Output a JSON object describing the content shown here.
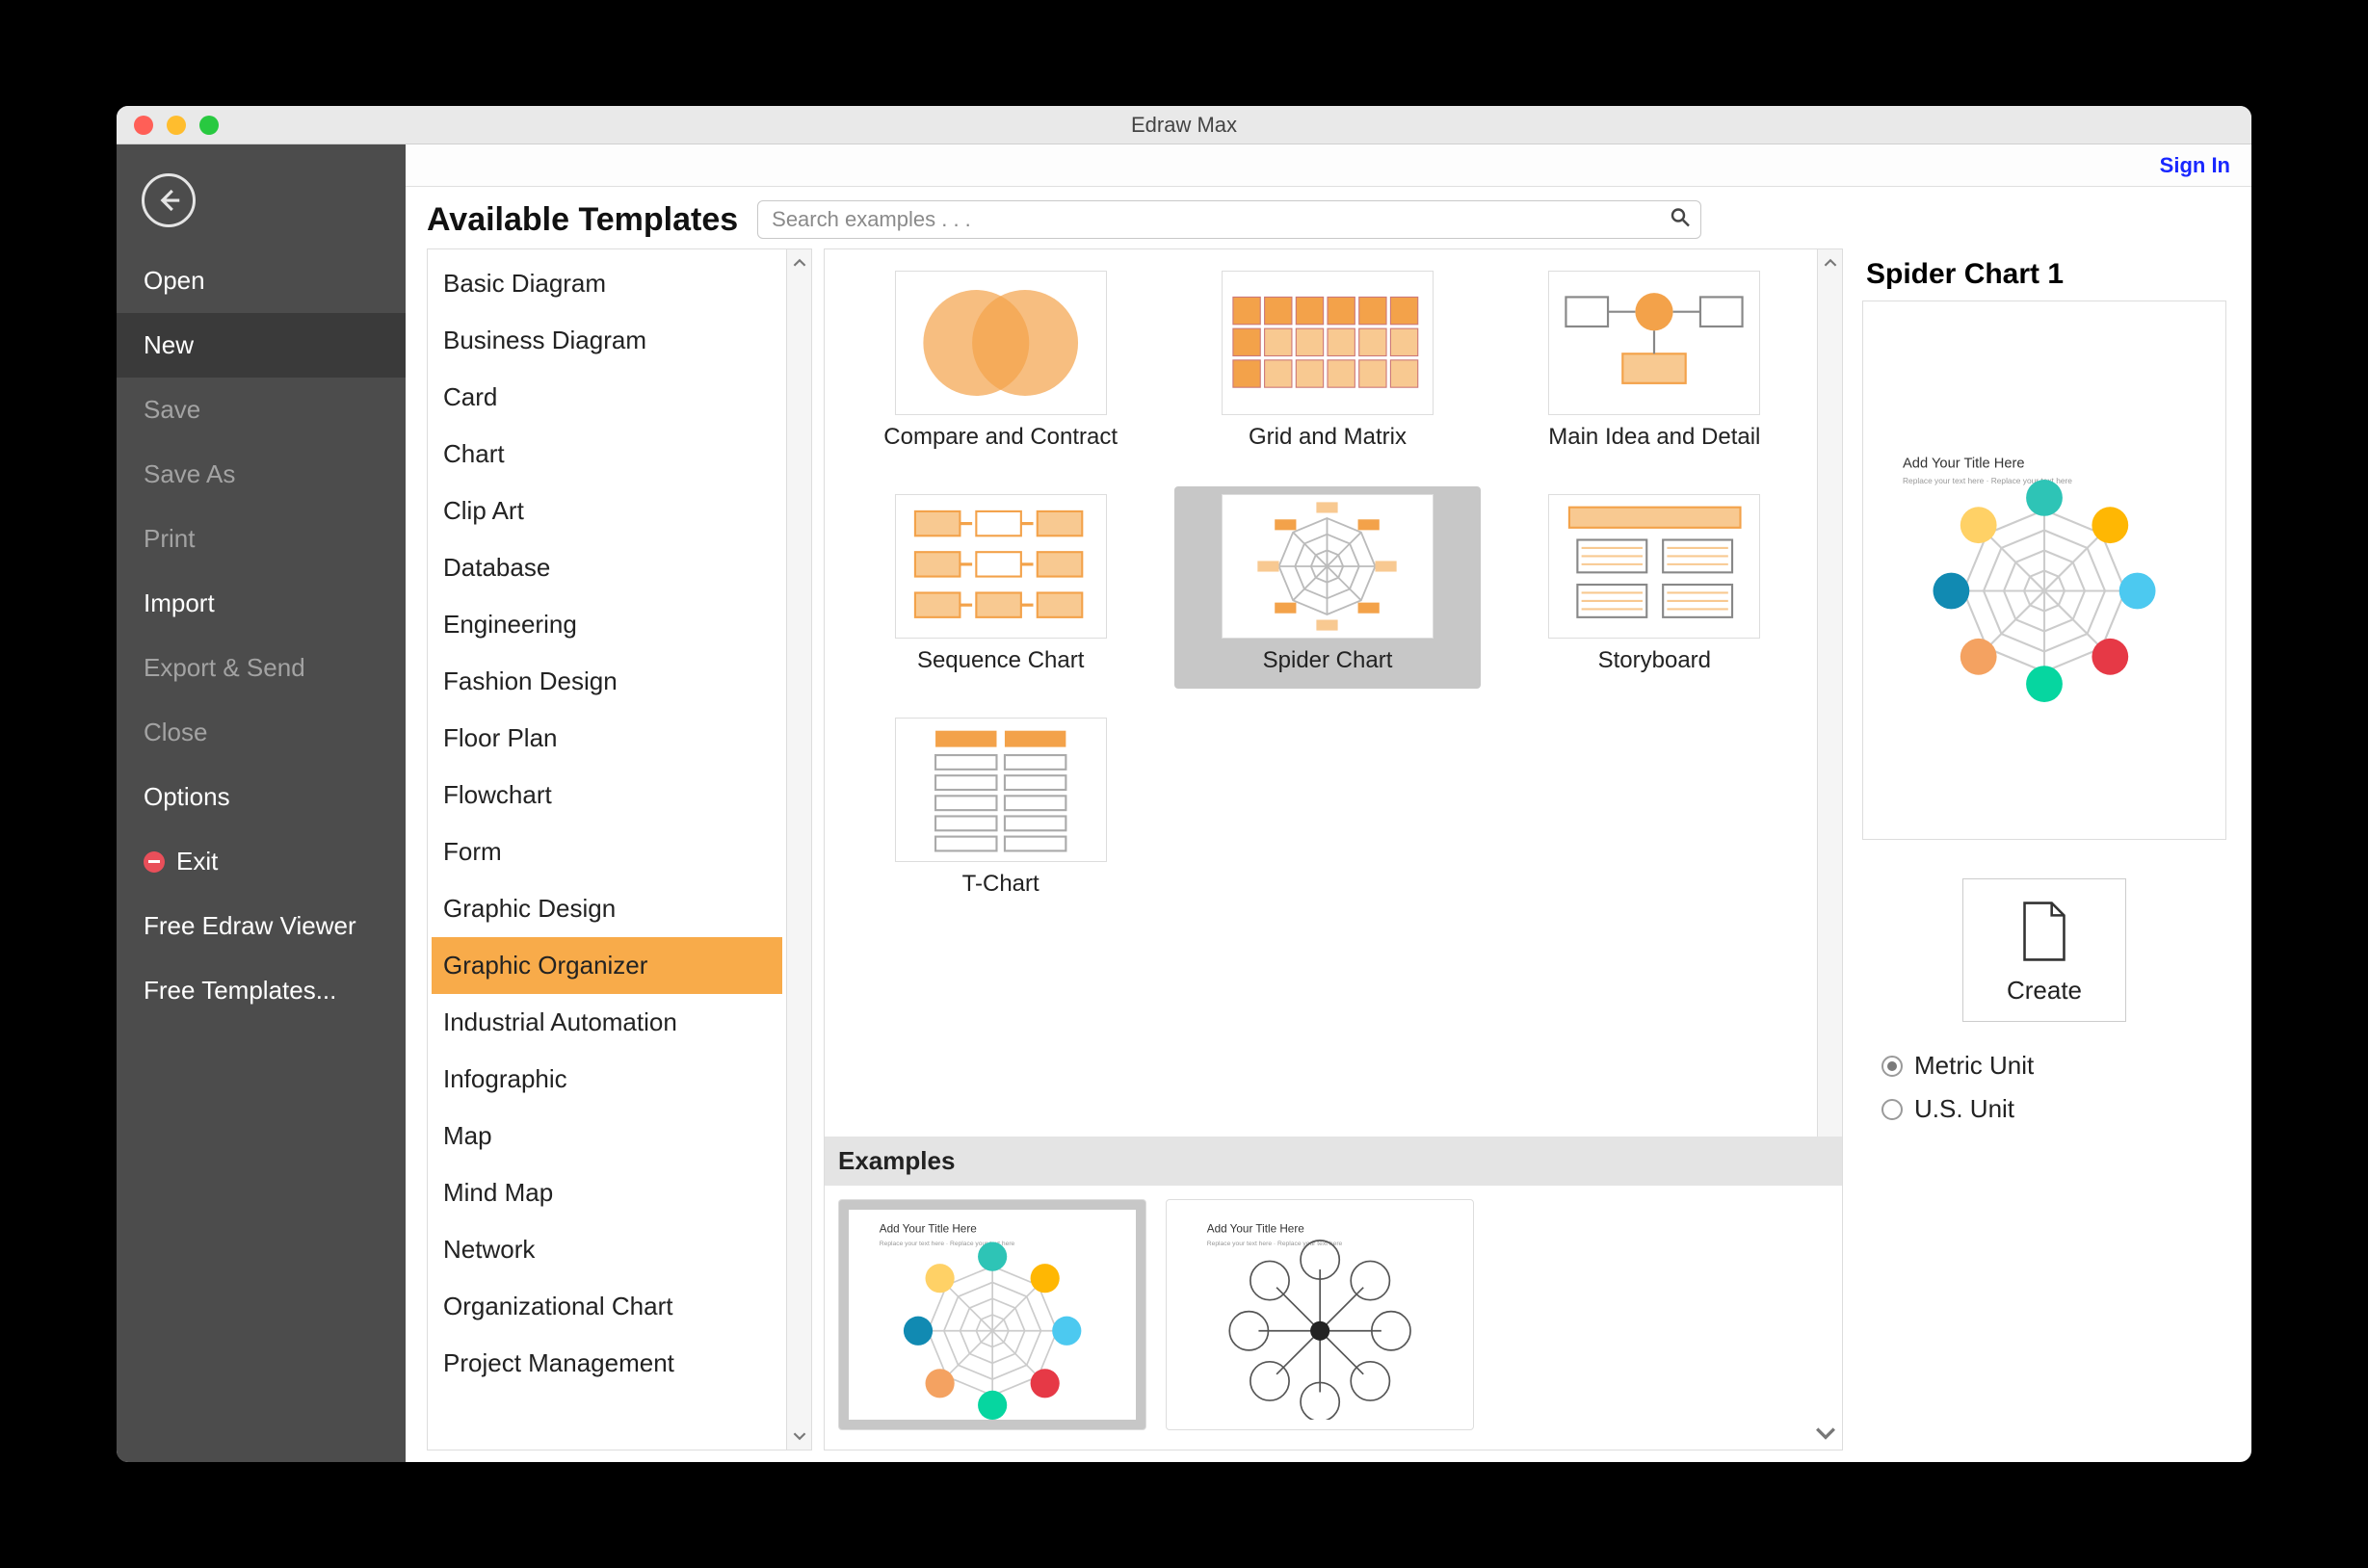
{
  "window": {
    "title": "Edraw Max",
    "signin": "Sign In"
  },
  "sidebar": {
    "items": [
      {
        "label": "Open",
        "dim": false
      },
      {
        "label": "New",
        "dim": false,
        "selected": true
      },
      {
        "label": "Save",
        "dim": true
      },
      {
        "label": "Save As",
        "dim": true
      },
      {
        "label": "Print",
        "dim": true
      },
      {
        "label": "Import",
        "dim": false
      },
      {
        "label": "Export & Send",
        "dim": true
      },
      {
        "label": "Close",
        "dim": true
      },
      {
        "label": "Options",
        "dim": false
      },
      {
        "label": "Exit",
        "dim": false,
        "exit": true
      },
      {
        "label": "Free Edraw Viewer",
        "dim": false
      },
      {
        "label": "Free Templates...",
        "dim": false
      }
    ]
  },
  "header": {
    "title": "Available Templates",
    "search_placeholder": "Search examples . . ."
  },
  "categories": [
    "Basic Diagram",
    "Business Diagram",
    "Card",
    "Chart",
    "Clip Art",
    "Database",
    "Engineering",
    "Fashion Design",
    "Floor Plan",
    "Flowchart",
    "Form",
    "Graphic Design",
    "Graphic Organizer",
    "Industrial Automation",
    "Infographic",
    "Map",
    "Mind Map",
    "Network",
    "Organizational Chart",
    "Project Management"
  ],
  "categories_selected": "Graphic Organizer",
  "templates": [
    {
      "label": "Compare and Contract",
      "kind": "venn"
    },
    {
      "label": "Grid and Matrix",
      "kind": "grid"
    },
    {
      "label": "Main Idea and Detail",
      "kind": "mainidea"
    },
    {
      "label": "Sequence Chart",
      "kind": "sequence"
    },
    {
      "label": "Spider Chart",
      "kind": "spider",
      "selected": true
    },
    {
      "label": "Storyboard",
      "kind": "storyboard"
    },
    {
      "label": "T-Chart",
      "kind": "tchart"
    }
  ],
  "examples_header": "Examples",
  "examples": [
    {
      "kind": "spider-color",
      "selected": true
    },
    {
      "kind": "spider-outline"
    }
  ],
  "right": {
    "title": "Spider Chart 1",
    "create_label": "Create",
    "unit_metric": "Metric Unit",
    "unit_us": "U.S. Unit",
    "unit_selected": "metric"
  }
}
